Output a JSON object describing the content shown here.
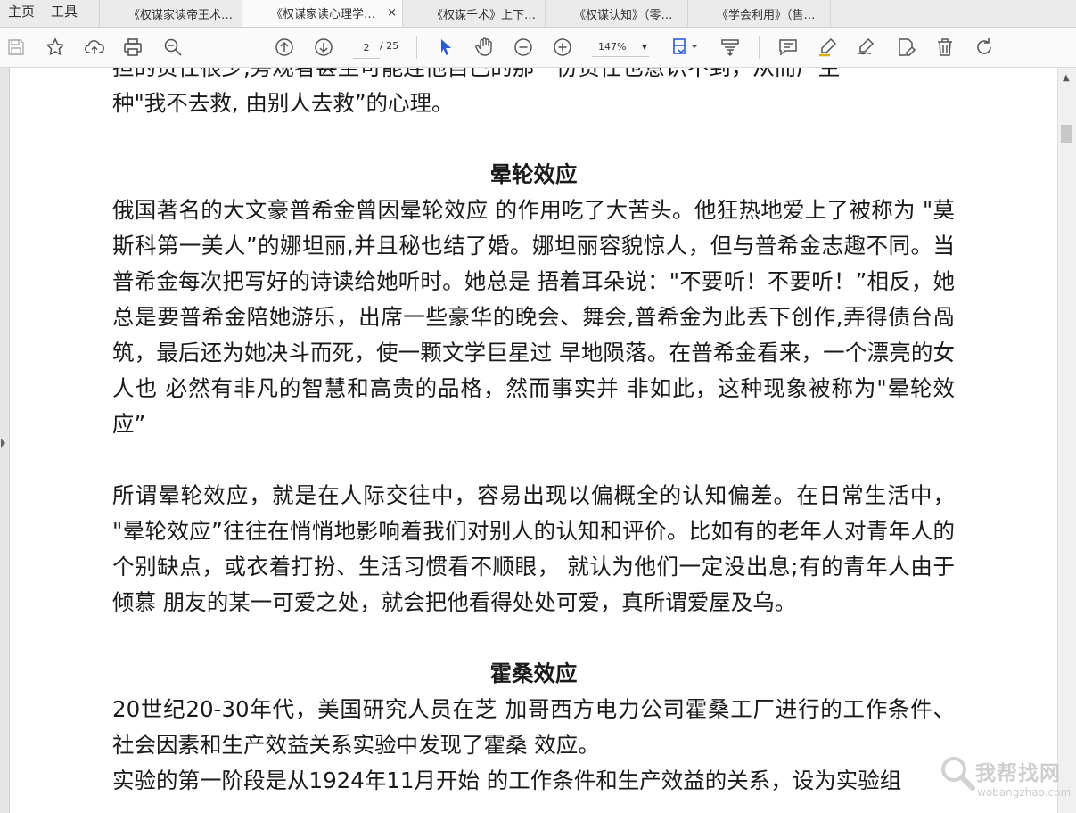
{
  "menu": {
    "home": "主页",
    "tools": "工具"
  },
  "tabs": [
    {
      "label": "《权谋家读帝王术…",
      "active": false
    },
    {
      "label": "《权谋家读心理学…",
      "active": true
    },
    {
      "label": "《权谋千术》上下…",
      "active": false
    },
    {
      "label": "《权谋认知》（零…",
      "active": false
    },
    {
      "label": "《学会利用》（售…",
      "active": false
    }
  ],
  "tab_close": "×",
  "toolbar": {
    "page_current": "2",
    "page_total": "/ 25",
    "zoom": "147%",
    "icons": [
      "save-icon",
      "bookmark-star-icon",
      "cloud-upload-icon",
      "print-icon",
      "zoom-search-icon",
      "page-up-icon",
      "page-down-icon",
      "select-cursor-icon",
      "hand-pan-icon",
      "zoom-out-icon",
      "zoom-in-icon",
      "fit-page-icon",
      "read-mode-icon",
      "comment-icon",
      "highlight-icon",
      "sign-icon",
      "edit-page-icon",
      "delete-icon",
      "rotate-icon"
    ]
  },
  "document": {
    "clipped_top_line": "担的责任很少,旁观者甚至可能连他自己的那一份责任也意识不到，从而产生一",
    "intro_tail": "种\"我不去救, 由别人去救”的心理。",
    "section1_title": "晕轮效应",
    "section1_p1": "俄国著名的大文豪普希金曾因晕轮效应 的作用吃了大苦头。他狂热地爱上了被称为 \"莫斯科第一美人”的娜坦丽,并且秘也结了婚。娜坦丽容貌惊人，但与普希金志趣不同。当普希金每次把写好的诗读给她听时。她总是 捂着耳朵说：\"不要听！不要听！”相反，她 总是要普希金陪她游乐，出席一些豪华的晚会、舞会,普希金为此丢下创作,弄得债台咼 筑，最后还为她决斗而死，使一颗文学巨星过 早地陨落。在普希金看来，一个漂亮的女人也 必然有非凡的智慧和高贵的品格，然而事实并 非如此，这种现象被称为\"晕轮效应”",
    "section1_p2": "所谓晕轮效应，就是在人际交往中，容易出现以偏概全的认知偏差。在日常生活中， \"晕轮效应”往往在悄悄地影响着我们对别人的认知和评价。比如有的老年人对青年人的个别缺点，或衣着打扮、生活习惯看不顺眼， 就认为他们一定没出息;有的青年人由于倾慕 朋友的某一可爱之处，就会把他看得处处可爱，真所谓爱屋及乌。",
    "section2_title": "霍桑效应",
    "section2_p1": "20世纪20-30年代，美国研究人员在芝 加哥西方电力公司霍桑工厂进行的工作条件、 社会因素和生产效益关系实验中发现了霍桑 效应。",
    "section2_p2": "实验的第一阶段是从1924年11月开始 的工作条件和生产效益的关系，设为实验组"
  },
  "watermark": {
    "text": "我帮找网",
    "sub": "wobangzhao.com"
  }
}
